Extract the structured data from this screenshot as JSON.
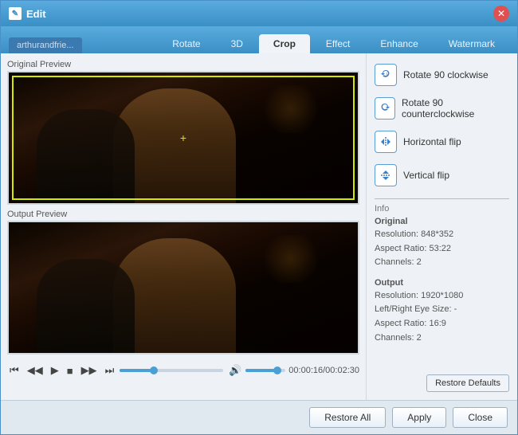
{
  "window": {
    "title": "Edit",
    "close_icon": "✕"
  },
  "file_tab": {
    "label": "arthurandfrie..."
  },
  "tabs": {
    "items": [
      {
        "label": "Rotate",
        "active": false
      },
      {
        "label": "3D",
        "active": false
      },
      {
        "label": "Crop",
        "active": true
      },
      {
        "label": "Effect",
        "active": false
      },
      {
        "label": "Enhance",
        "active": false
      },
      {
        "label": "Watermark",
        "active": false
      }
    ]
  },
  "previews": {
    "original_label": "Original Preview",
    "output_label": "Output Preview"
  },
  "controls": {
    "skip_back": "⏮",
    "step_back": "⏭",
    "play": "▶",
    "stop": "⏹",
    "step_fwd": "⏭",
    "skip_fwd": "⏭",
    "volume_icon": "🔊",
    "time": "00:00:16/00:02:30"
  },
  "actions": [
    {
      "label": "Rotate 90 clockwise",
      "icon": "↻"
    },
    {
      "label": "Rotate 90 counterclockwise",
      "icon": "↺"
    },
    {
      "label": "Horizontal flip",
      "icon": "⇔"
    },
    {
      "label": "Vertical flip",
      "icon": "⇕"
    }
  ],
  "info": {
    "section_title": "Info",
    "original_title": "Original",
    "original_resolution": "Resolution: 848*352",
    "original_aspect": "Aspect Ratio: 53:22",
    "original_channels": "Channels: 2",
    "output_title": "Output",
    "output_resolution": "Resolution: 1920*1080",
    "output_lr_size": "Left/Right Eye Size: -",
    "output_aspect": "Aspect Ratio: 16:9",
    "output_channels": "Channels: 2"
  },
  "buttons": {
    "restore_defaults": "Restore Defaults",
    "restore_all": "Restore All",
    "apply": "Apply",
    "close": "Close"
  }
}
